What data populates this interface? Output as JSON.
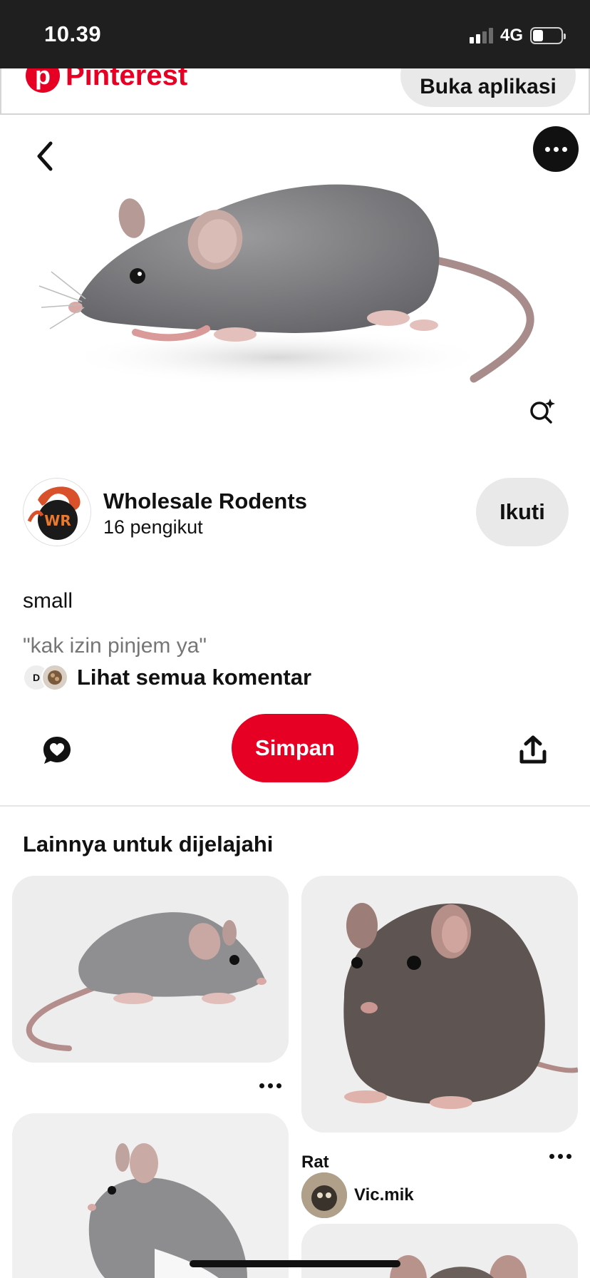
{
  "status_bar": {
    "time": "10.39",
    "network": "4G",
    "signal_bars_on": 2,
    "signal_bars_total": 4,
    "battery_level": 0.3
  },
  "header": {
    "brand": "Pinterest",
    "brand_mark": "p",
    "open_app_label": "Buka aplikasi",
    "brand_color": "#e60023"
  },
  "pin": {
    "author": {
      "name": "Wholesale Rodents",
      "followers": "16 pengikut",
      "avatar_initials": "WR"
    },
    "follow_label": "Ikuti",
    "description": "small",
    "comment_preview": "\"kak izin pinjem ya\"",
    "commenter_initial": "D",
    "see_all_comments": "Lihat semua komentar",
    "save_label": "Simpan"
  },
  "explore": {
    "title": "Lainnya untuk dijelajahi",
    "cards": [
      {
        "image": "grey-mouse-walking"
      },
      {
        "image": "brown-rat-sitting",
        "title": "Rat",
        "author": "Vic.mik"
      },
      {
        "image": "grey-mouse-standing"
      },
      {
        "image": "rat-partial"
      }
    ]
  },
  "icons": {
    "back": "chevron-left-icon",
    "more": "more-dots-icon",
    "visual_search": "visual-search-icon",
    "react": "heart-bubble-icon",
    "share": "share-icon"
  }
}
